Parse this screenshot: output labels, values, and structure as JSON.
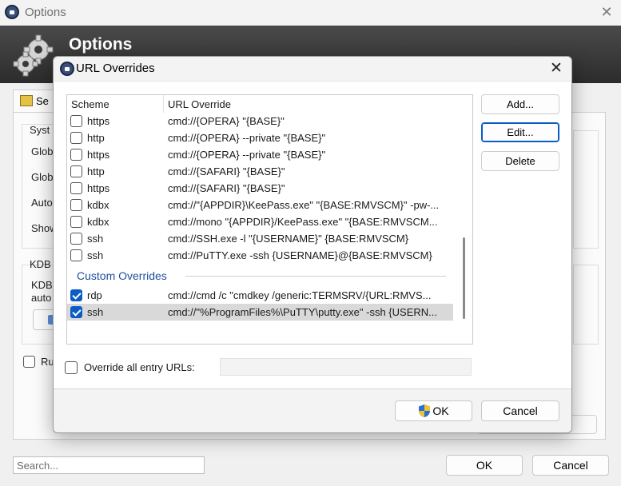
{
  "background_window": {
    "title": "Options",
    "banner_title": "Options",
    "tab_label": "Se",
    "group1_label": "Syst",
    "items": [
      "Glob",
      "Glob",
      "Auto",
      "Show"
    ],
    "group2_label": "KDB",
    "group2_text_lines": [
      "KDB",
      "auto"
    ],
    "run_label": "Ru",
    "search_placeholder": "Search...",
    "ok_label": "OK",
    "cancel_label": "Cancel"
  },
  "dialog": {
    "title": "URL Overrides",
    "columns": {
      "scheme": "Scheme",
      "override": "URL Override"
    },
    "builtin_rows": [
      {
        "checked": false,
        "scheme": "https",
        "override": "cmd://{OPERA} \"{BASE}\""
      },
      {
        "checked": false,
        "scheme": "http",
        "override": "cmd://{OPERA} --private \"{BASE}\""
      },
      {
        "checked": false,
        "scheme": "https",
        "override": "cmd://{OPERA} --private \"{BASE}\""
      },
      {
        "checked": false,
        "scheme": "http",
        "override": "cmd://{SAFARI} \"{BASE}\""
      },
      {
        "checked": false,
        "scheme": "https",
        "override": "cmd://{SAFARI} \"{BASE}\""
      },
      {
        "checked": false,
        "scheme": "kdbx",
        "override": "cmd://\"{APPDIR}\\KeePass.exe\" \"{BASE:RMVSCM}\" -pw-..."
      },
      {
        "checked": false,
        "scheme": "kdbx",
        "override": "cmd://mono \"{APPDIR}/KeePass.exe\" \"{BASE:RMVSCM..."
      },
      {
        "checked": false,
        "scheme": "ssh",
        "override": "cmd://SSH.exe -l \"{USERNAME}\" {BASE:RMVSCM}"
      },
      {
        "checked": false,
        "scheme": "ssh",
        "override": "cmd://PuTTY.exe -ssh {USERNAME}@{BASE:RMVSCM}"
      }
    ],
    "custom_group_label": "Custom Overrides",
    "custom_rows": [
      {
        "checked": true,
        "selected": false,
        "scheme": "rdp",
        "override": "cmd://cmd /c \"cmdkey /generic:TERMSRV/{URL:RMVS..."
      },
      {
        "checked": true,
        "selected": true,
        "scheme": "ssh",
        "override": "cmd://\"%ProgramFiles%\\PuTTY\\putty.exe\" -ssh {USERN..."
      }
    ],
    "buttons": {
      "add": "Add...",
      "edit": "Edit...",
      "delete": "Delete"
    },
    "override_all_label": "Override all entry URLs:",
    "override_all_value": "",
    "ok_label": "OK",
    "cancel_label": "Cancel"
  },
  "icons": {
    "app": "keepass-lock-icon",
    "banner": "gears-icon",
    "uac": "uac-shield-icon",
    "close": "close-icon"
  },
  "colors": {
    "accent": "#0b5cc5",
    "group_header": "#1f4e9a",
    "selected_row": "#d9d9d9"
  }
}
